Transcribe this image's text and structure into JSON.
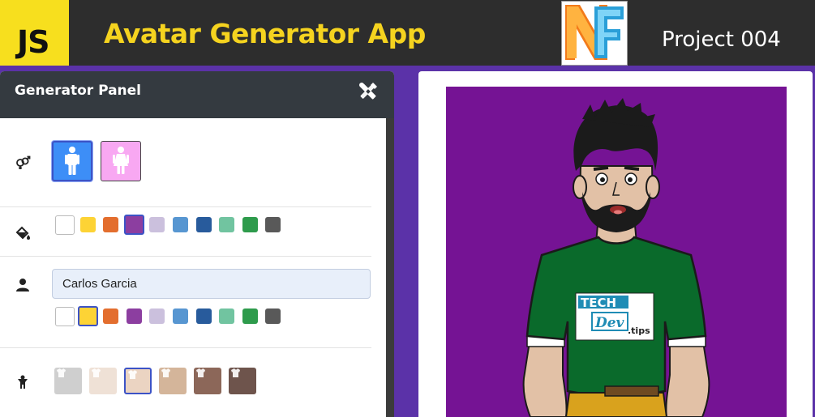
{
  "header": {
    "js_logo_text": "JS",
    "title": "Avatar Generator App",
    "project": "Project 004",
    "colors": {
      "bar": "#2d2d2d",
      "js_yellow": "#f7df1e",
      "title_yellow": "#f5d31f"
    }
  },
  "panel": {
    "title": "Generator Panel",
    "sections": {
      "gender": {
        "icon": "gender-icon",
        "options": [
          "male",
          "female"
        ],
        "selected": "male"
      },
      "background_color": {
        "icon": "paint-bucket-icon",
        "swatches": [
          "#ffffff",
          "#fdd335",
          "#e36e2e",
          "#8c3ea0",
          "#cbc0dd",
          "#5796d1",
          "#285b9c",
          "#71c4a0",
          "#2e9b4c",
          "#595959"
        ],
        "selected_index": 3
      },
      "name": {
        "icon": "user-icon",
        "value": "Carlos Garcia",
        "text_colors": [
          "#ffffff",
          "#fdd335",
          "#e36e2e",
          "#8c3ea0",
          "#cbc0dd",
          "#5796d1",
          "#285b9c",
          "#71c4a0",
          "#2e9b4c",
          "#595959"
        ],
        "selected_index": 1
      },
      "skin_tone": {
        "icon": "child-icon",
        "tones": [
          "#cfcfcf",
          "#efe1d6",
          "#ebd4c2",
          "#d4b59a",
          "#8c6759",
          "#6e544c"
        ],
        "selected_index": 2
      }
    }
  },
  "preview": {
    "background": "#751394",
    "shirt_badge": {
      "line1": "TECH",
      "line2": "Dev",
      "line3": ".tips"
    }
  }
}
